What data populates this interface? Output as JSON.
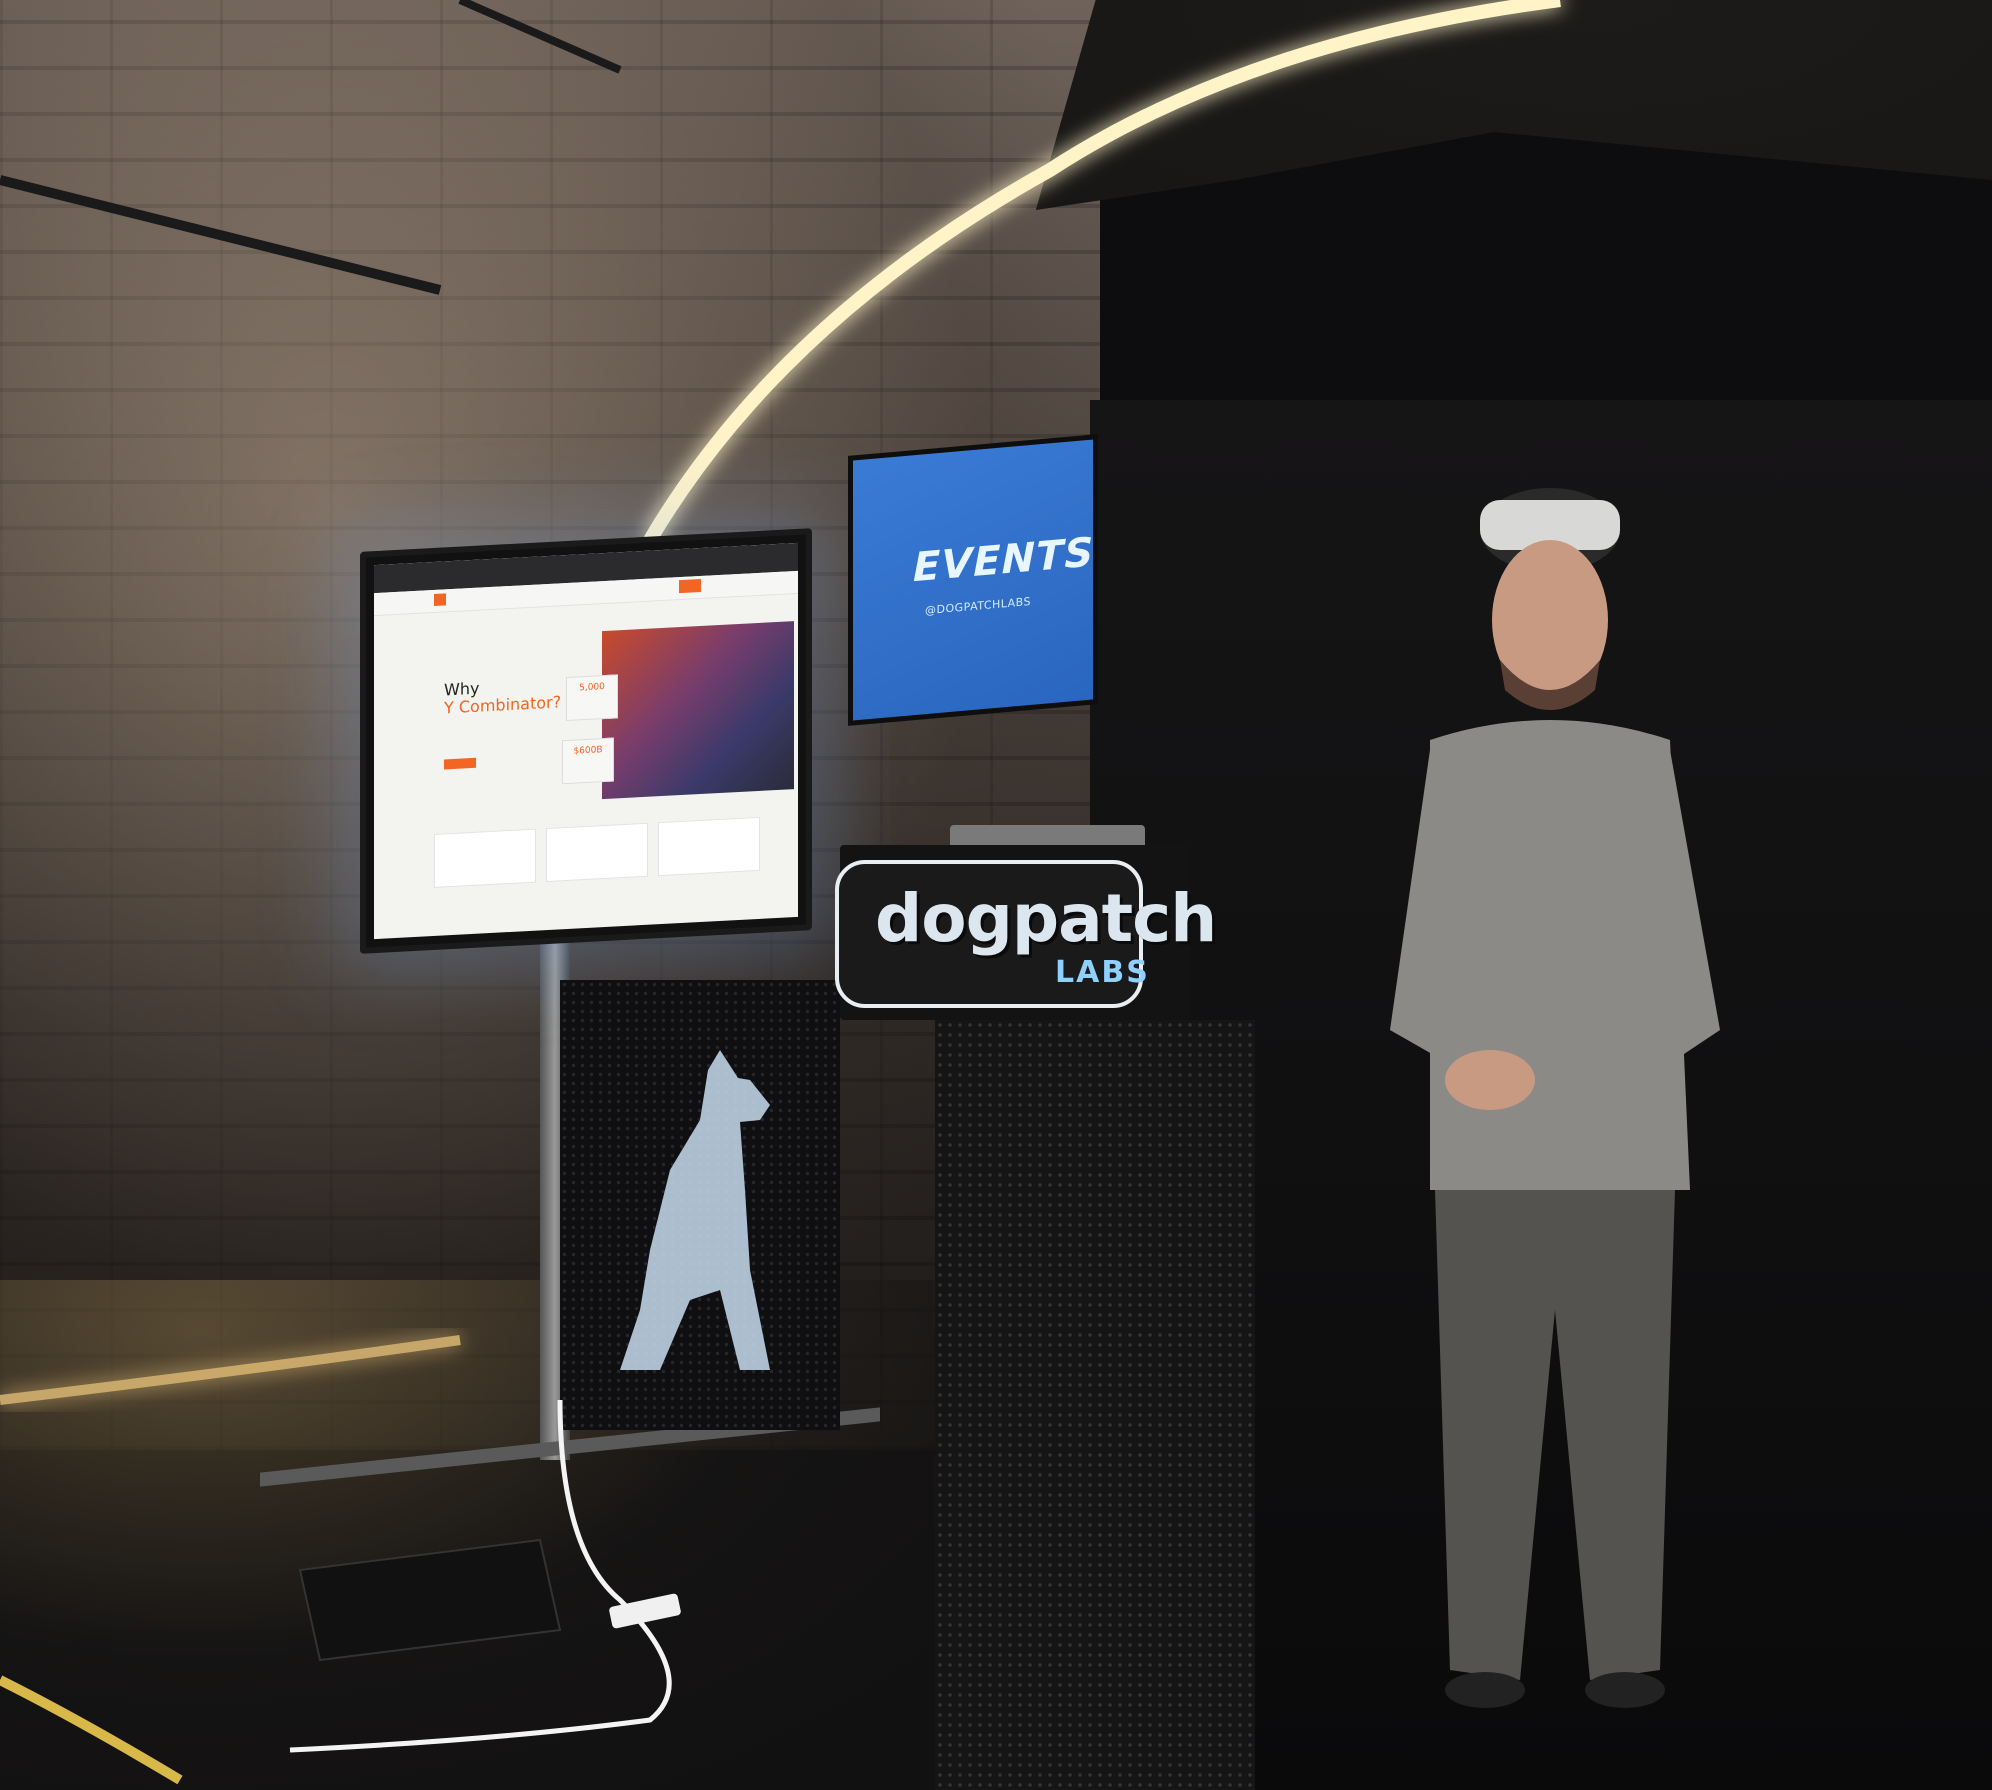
{
  "tv_screen": {
    "hero_line1": "Why",
    "hero_line2": "Y Combinator?",
    "stat1": "5,000",
    "stat2": "$600B"
  },
  "events_screen": {
    "title": "EVENTS",
    "handle": "@DOGPATCHLABS"
  },
  "podium": {
    "logo_text": "dogpatch",
    "logo_sub": "LABS"
  },
  "colors": {
    "yc_orange": "#f26522",
    "events_blue": "#3a7bd5",
    "labs_blue": "#8fd0ff"
  }
}
